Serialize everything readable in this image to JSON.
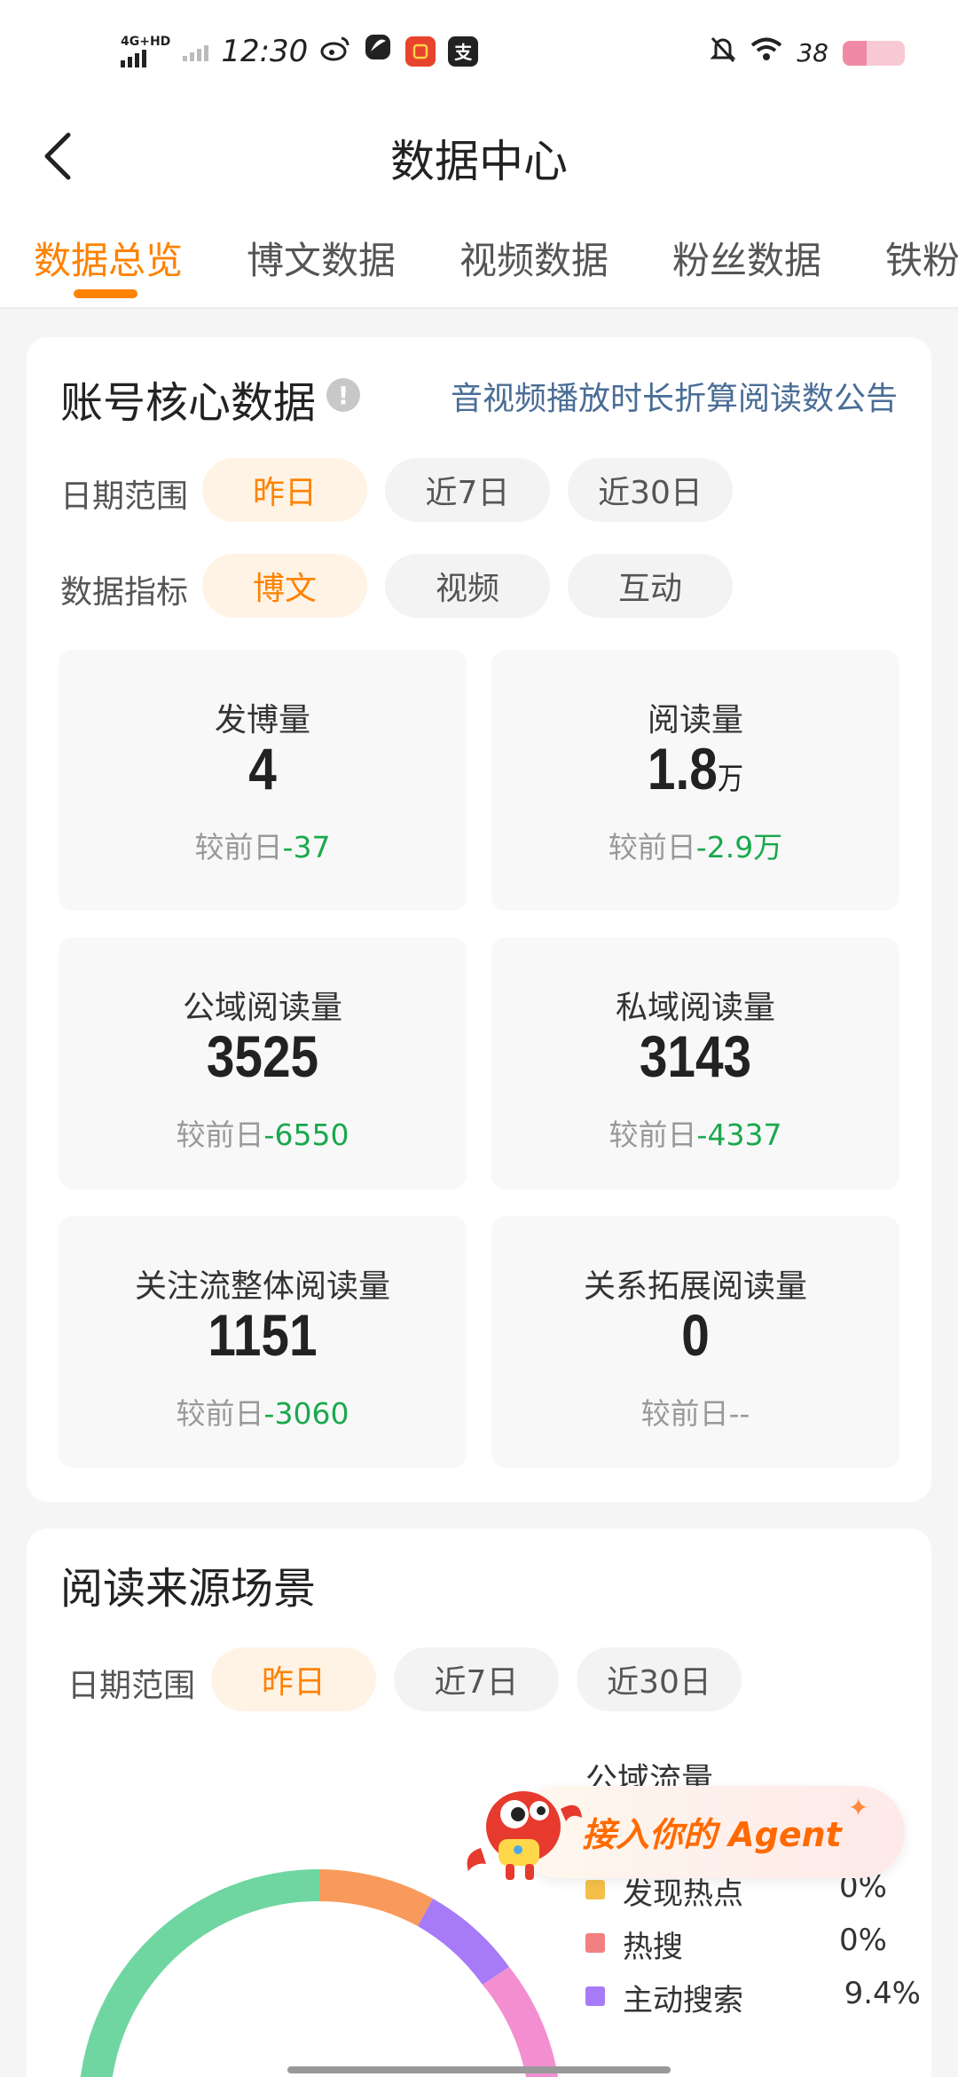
{
  "status_bar": {
    "network": "4G+HD",
    "time": "12:30",
    "apps": [
      "weibo-icon",
      "swirl-app-icon",
      "red-app-icon",
      "alipay-icon"
    ],
    "alipay_glyph": "支",
    "battery_text": "38",
    "battery_level": 0.38
  },
  "header": {
    "title": "数据中心"
  },
  "tabs": [
    "数据总览",
    "博文数据",
    "视频数据",
    "粉丝数据",
    "铁粉"
  ],
  "core": {
    "title": "账号核心数据",
    "info_glyph": "!",
    "notice": "音视频播放时长折算阅读数公告",
    "date_label": "日期范围",
    "date_options": [
      "昨日",
      "近7日",
      "近30日"
    ],
    "metric_label": "数据指标",
    "metric_options": [
      "博文",
      "视频",
      "互动"
    ],
    "stats": [
      {
        "label": "发博量",
        "value": "4",
        "unit": "",
        "change_prefix": "较前日",
        "change": "-37"
      },
      {
        "label": "阅读量",
        "value": "1.8",
        "unit": "万",
        "change_prefix": "较前日",
        "change": "-2.9万"
      },
      {
        "label": "公域阅读量",
        "value": "3525",
        "unit": "",
        "change_prefix": "较前日",
        "change": "-6550"
      },
      {
        "label": "私域阅读量",
        "value": "3143",
        "unit": "",
        "change_prefix": "较前日",
        "change": "-4337"
      },
      {
        "label": "关注流整体阅读量",
        "value": "1151",
        "unit": "",
        "change_prefix": "较前日",
        "change": "-3060"
      },
      {
        "label": "关系拓展阅读量",
        "value": "0",
        "unit": "",
        "change_prefix": "较前日",
        "change": "--"
      }
    ]
  },
  "source": {
    "title": "阅读来源场景",
    "date_label": "日期范围",
    "date_options": [
      "昨日",
      "近7日",
      "近30日"
    ],
    "legend_header": "公域流量",
    "legend": [
      {
        "name": "发现热点",
        "value": "0%",
        "color": "#f5c04a"
      },
      {
        "name": "热搜",
        "value": "0%",
        "color": "#f28080"
      },
      {
        "name": "主动搜索",
        "value": "9.4%",
        "color": "#a77bf7"
      }
    ],
    "donut_colors": [
      "#6fd6a1",
      "#f89a5b",
      "#a77bf7",
      "#f38fd0"
    ]
  },
  "agent": {
    "text": "接入你的 Agent",
    "spark": "✦"
  }
}
